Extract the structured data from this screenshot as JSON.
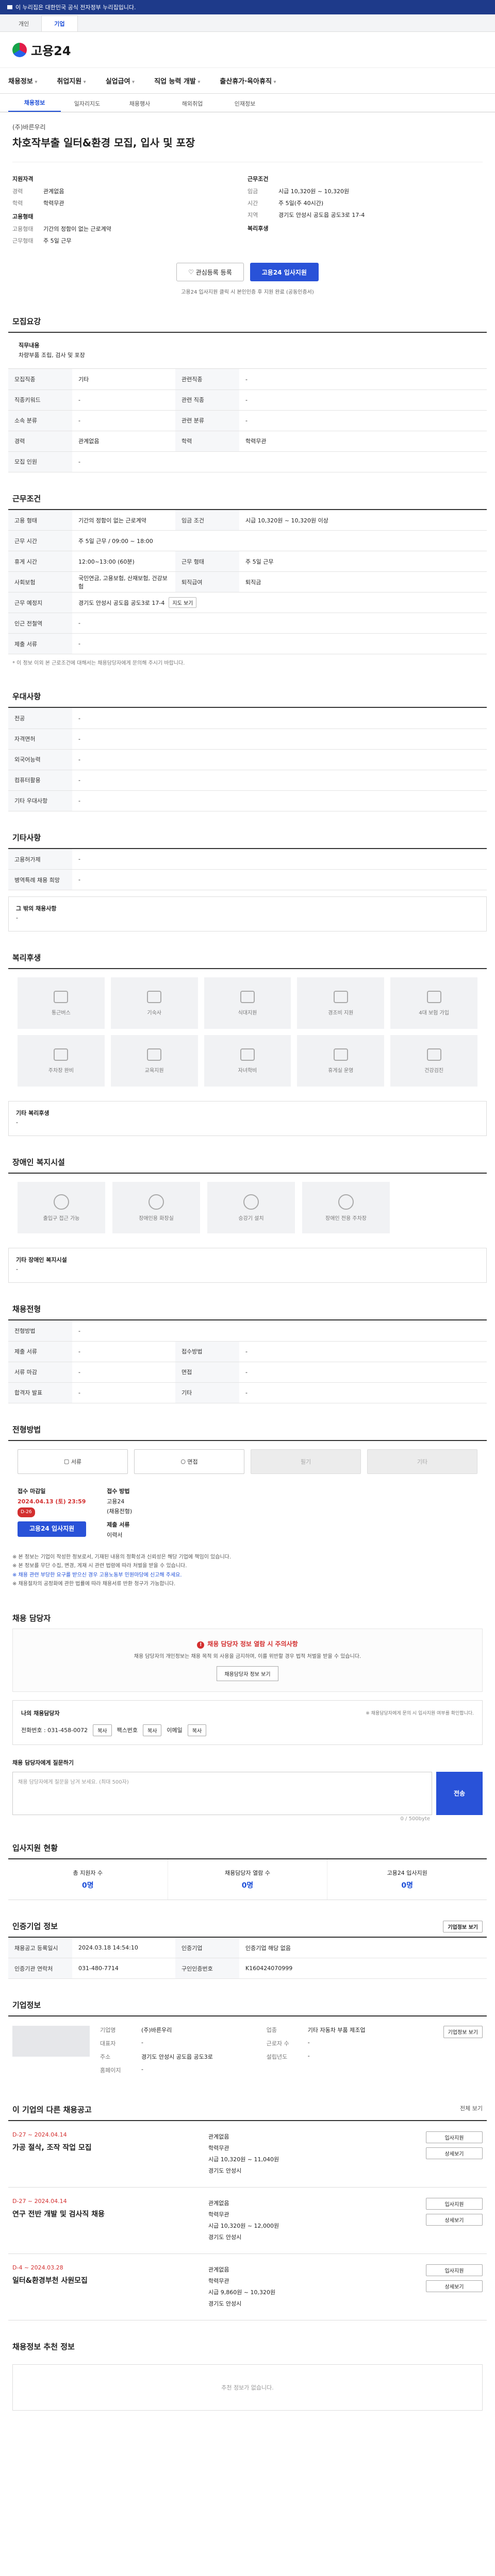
{
  "top": {
    "notice": "이 누리집은 대한민국 공식 전자정부 누리집입니다."
  },
  "toptabs": [
    "개인",
    "기업"
  ],
  "header": {
    "logo": "고용24"
  },
  "gnb": [
    "채용정보",
    "취업지원",
    "실업급여",
    "직업 능력 개발",
    "출산휴가·육아휴직"
  ],
  "subtabs": [
    "채용정보",
    "일자리지도",
    "채용행사",
    "해외취업",
    "인재정보"
  ],
  "job": {
    "company": "(주)바른우리",
    "title": "차호작부출 일터&환경 모집, 입사 및 포장",
    "summary_left_title": "지원자격",
    "summary_left": [
      [
        "경력",
        "관계없음"
      ],
      [
        "학력",
        "학력무관"
      ]
    ],
    "summary_left_title2": "고용형태",
    "summary_left2": [
      [
        "고용형태",
        "기간의 정함이 없는 근로계약"
      ],
      [
        "근무형태",
        "주 5일 근무"
      ]
    ],
    "summary_right_title": "근무조건",
    "summary_right": [
      [
        "임금",
        "시급 10,320원 ~ 10,320원"
      ],
      [
        "시간",
        "주 5일(주 40시간)"
      ],
      [
        "지역",
        "경기도 안성시 공도읍 공도3로 17-4"
      ]
    ],
    "summary_right_title2": "복리후생"
  },
  "buttons": {
    "interest": "관심등록 등록",
    "apply": "고용24 입사지원"
  },
  "note": "고용24 입사지원 클릭 시 본인인증 후 지원 완료 (공동인증서)",
  "recruit": {
    "title": "모집요강",
    "content_head": "직무내용",
    "content": "차량부품 조립, 검사 및 포장",
    "rows": [
      [
        "모집직종",
        "기타",
        "관련직종",
        "-"
      ],
      [
        "직종키워드",
        "-",
        "관련 직종",
        "-"
      ],
      [
        "소속 분류",
        "-",
        "관련 분류",
        "-"
      ],
      [
        "경력",
        "관계없음",
        "학력",
        "학력무관"
      ],
      [
        "모집 인원",
        "-",
        "",
        ""
      ]
    ]
  },
  "conditions": {
    "title": "근무조건",
    "rows": [
      [
        "고용 형태",
        "기간의 정함이 없는 근로계약",
        "임금 조건",
        "시급 10,320원 ~ 10,320원 이상"
      ],
      [
        "근무 시간",
        "주 5일 근무 / 09:00 ~ 18:00",
        "",
        ""
      ],
      [
        "휴게 시간",
        "12:00~13:00 (60분)",
        "근무 형태",
        "주 5일 근무"
      ],
      [
        "사회보험",
        "국민연금, 고용보험, 산재보험, 건강보험",
        "퇴직급여",
        "퇴직금"
      ],
      [
        "근무 예정지",
        "경기도 안성시 공도읍 공도3로 17-4",
        "",
        ""
      ],
      [
        "인근 전철역",
        "-",
        "",
        ""
      ],
      [
        "제출 서류",
        "-",
        "",
        ""
      ]
    ],
    "note": "* 이 정보 이외 본 근로조건에 대해서는 채용담당자에게 문의해 주시기 바랍니다.",
    "map_button": "지도 보기"
  },
  "preference": {
    "title": "우대사항",
    "rows": [
      [
        "전공",
        "-"
      ],
      [
        "자격면허",
        "-"
      ],
      [
        "외국어능력",
        "-"
      ],
      [
        "컴퓨터활용",
        "-"
      ],
      [
        "기타 우대사항",
        "-"
      ]
    ]
  },
  "etc": {
    "title": "기타사항",
    "rows": [
      [
        "고용허가제",
        "-"
      ],
      [
        "병역특례 채용 희망",
        "-"
      ]
    ],
    "text_head": "그 밖의 채용사항",
    "text": "-"
  },
  "welfare": {
    "title": "복리후생",
    "items": [
      "통근버스",
      "기숙사",
      "식대지원",
      "경조비 지원",
      "4대 보험 가입",
      "주차장 완비",
      "교육지원",
      "자녀학비",
      "휴게실 운영",
      "건강검진"
    ],
    "other_head": "기타 복리후생",
    "other": "-"
  },
  "disabled": {
    "title": "장애인 복지시설",
    "items": [
      "출입구 접근 가능",
      "장애인용 화장실",
      "승강기 설치",
      "장애인 전용 주차장"
    ],
    "other_head": "기타 장애인 복지시설",
    "other": "-"
  },
  "selection": {
    "title": "채용전형",
    "rows": [
      [
        "전형방법",
        "-",
        "",
        ""
      ],
      [
        "제출 서류",
        "-",
        "접수방법",
        "-"
      ],
      [
        "서류 마감",
        "-",
        "면접",
        "-"
      ],
      [
        "합격자 발표",
        "-",
        "기타",
        "-"
      ]
    ]
  },
  "apply_method": {
    "title": "전형방법",
    "methods": [
      "서류",
      "면접",
      "필기",
      "기타"
    ],
    "deadline_label": "접수 마감일",
    "deadline": "2024.04.13 (토) 23:59",
    "dday": "D-26",
    "apply_button": "고용24 입사지원",
    "process_label": "접수 방법",
    "process": [
      "고용24",
      "(채용전형)"
    ],
    "method_label": "제출 서류",
    "method_value": "이력서"
  },
  "bullets": [
    "※ 본 정보는 기업이 작성한 정보로서, 기재된 내용의 정확성과 신뢰성은 해당 기업에 책임이 있습니다.",
    "※ 본 정보를 무단 수집, 변경, 게재 시 관련 법령에 따라 처벌을 받을 수 있습니다.",
    "※ 채용 관련 부당한 요구를 받으신 경우 고용노동부 민원마당에 신고해 주세요.",
    "※ 채용절차의 공정화에 관한 법률에 따라 채용서류 반환 청구가 가능합니다."
  ],
  "manager": {
    "title": "채용 담당자",
    "warn": "채용 담당자 정보 열람 시 주의사항",
    "text": "채용 담당자의 개인정보는 채용 목적 외 사용을 금지하며, 이를 위반할 경우 법적 처벌을 받을 수 있습니다.",
    "button": "채용담당자 정보 보기",
    "name_label": "나의 채용담당자",
    "phone": "전화번호 : 031-458-0072",
    "fax_label": "팩스번호",
    "email_label": "이메일",
    "copy": "복사",
    "side_note": "※ 채용담당자에게 문의 시 입사지원 여부를 확인합니다."
  },
  "question": {
    "label": "채용 담당자에게 질문하기",
    "placeholder": "채용 담당자에게 질문을 남겨 보세요. (최대 500자)",
    "send": "전송",
    "counter": "0 / 500byte"
  },
  "stats": {
    "title": "입사지원 현황",
    "items": [
      [
        "총 지원자 수",
        "0명"
      ],
      [
        "채용담당자 열람 수",
        "0명"
      ],
      [
        "고용24 입사지원",
        "0명"
      ]
    ]
  },
  "info": {
    "title": "인증기업 정보",
    "rows": [
      [
        "채용공고 등록일시",
        "2024.03.18 14:54:10",
        "인증기업",
        "인증기업 해당 없음"
      ],
      [
        "인증기관 연락처",
        "031-480-7714",
        "구인인증번호",
        "K160424070999"
      ]
    ],
    "button": "기업정보 보기"
  },
  "corp": {
    "title": "기업정보",
    "rows": [
      [
        "기업명",
        "(주)바른우리",
        "업종",
        "기타 자동차 부품 제조업"
      ],
      [
        "대표자",
        "-",
        "근로자 수",
        "-"
      ],
      [
        "주소",
        "경기도 안성시 공도읍 공도3로",
        "설립년도",
        "-"
      ],
      [
        "홈페이지",
        "-",
        "",
        ""
      ]
    ],
    "button": "기업정보 보기"
  },
  "other_jobs": {
    "title": "이 기업의 다른 채용공고",
    "more": "전체 보기",
    "items": [
      {
        "period": "D-27 ~ 2024.04.14",
        "title": "가공 절삭, 조작 작업 모집",
        "wage": "시급 10,320원 ~ 11,040원",
        "career": "관계없음",
        "edu": "학력무관",
        "loc": "경기도 안성시"
      },
      {
        "period": "D-27 ~ 2024.04.14",
        "title": "연구 전반 개발 및 검사직 채용",
        "wage": "시급 10,320원 ~ 12,000원",
        "career": "관계없음",
        "edu": "학력무관",
        "loc": "경기도 안성시"
      },
      {
        "period": "D-4 ~ 2024.03.28",
        "title": "일터&환경부천 사원모집",
        "wage": "시급 9,860원 ~ 10,320원",
        "career": "관계없음",
        "edu": "학력무관",
        "loc": "경기도 안성시"
      }
    ],
    "btn_apply": "입사지원",
    "btn_detail": "상세보기"
  },
  "recommend": {
    "title": "채용정보 추천 정보",
    "empty": "추천 정보가 없습니다."
  }
}
